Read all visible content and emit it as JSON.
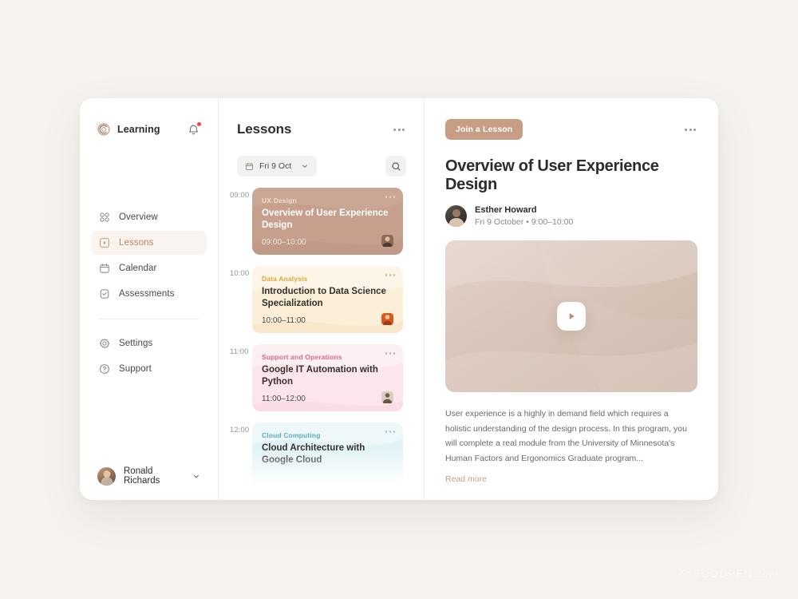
{
  "sidebar": {
    "brand": {
      "name": "Learning",
      "logo_icon": "spiral-logo-icon"
    },
    "notification": {
      "icon": "bell-icon",
      "has_unread": true
    },
    "items": [
      {
        "label": "Overview",
        "icon": "grid-icon",
        "active": false
      },
      {
        "label": "Lessons",
        "icon": "play-square-icon",
        "active": true
      },
      {
        "label": "Calendar",
        "icon": "calendar-icon",
        "active": false
      },
      {
        "label": "Assessments",
        "icon": "checklist-icon",
        "active": false
      }
    ],
    "lower_items": [
      {
        "label": "Settings",
        "icon": "gear-icon"
      },
      {
        "label": "Support",
        "icon": "question-circle-icon"
      }
    ],
    "user": {
      "name": "Ronald Richards",
      "chevron_icon": "chevron-down-icon"
    }
  },
  "lessons": {
    "title": "Lessons",
    "more_icon": "more-horizontal-icon",
    "date_filter": {
      "value": "Fri 9 Oct",
      "icon": "calendar-icon",
      "chevron_icon": "chevron-down-icon"
    },
    "search": {
      "icon": "search-icon",
      "placeholder": "Search"
    },
    "items": [
      {
        "time_label": "09:00",
        "category": "UX Design",
        "title": "Overview of User Experience Design",
        "time_range": "09:00–10:00",
        "variant": "c-ux",
        "accent": "#c6a08c",
        "has_avatar": true
      },
      {
        "time_label": "10:00",
        "category": "Data Analysis",
        "title": "Introduction to Data Science Specialization",
        "time_range": "10:00–11:00",
        "variant": "c-data",
        "accent": "#fcefd7",
        "has_avatar": true
      },
      {
        "time_label": "11:00",
        "category": "Support and Operations",
        "title": "Google IT Automation with Python",
        "time_range": "11:00–12:00",
        "variant": "c-sup",
        "accent": "#fce6ec",
        "has_avatar": true
      },
      {
        "time_label": "12:00",
        "category": "Cloud Computing",
        "title": "Cloud Architecture with Google Cloud",
        "time_range": "",
        "variant": "c-cloud",
        "accent": "#e1f3f6",
        "has_avatar": false
      }
    ]
  },
  "detail": {
    "join_label": "Join a Lesson",
    "more_icon": "more-horizontal-icon",
    "title": "Overview of User Experience Design",
    "instructor": {
      "name": "Esther Howard",
      "meta": "Fri 9 October • 9:00–10:00"
    },
    "video": {
      "play_icon": "play-icon"
    },
    "description": "User experience is a highly in demand field which requires a holistic understanding of the design process. In this program, you will complete a real module from the University of Minnesota's Human Factors and Ergonomics Graduate program...",
    "read_more_label": "Read more"
  },
  "watermark": {
    "text": "TOOOPEN.com"
  },
  "colors": {
    "page_background": "#f5f2ef",
    "card_background": "#ffffff",
    "accent": "#c79e83",
    "active_nav_background": "#faf3ee",
    "active_nav_text": "#b78562",
    "notification_dot": "#e8483c"
  }
}
